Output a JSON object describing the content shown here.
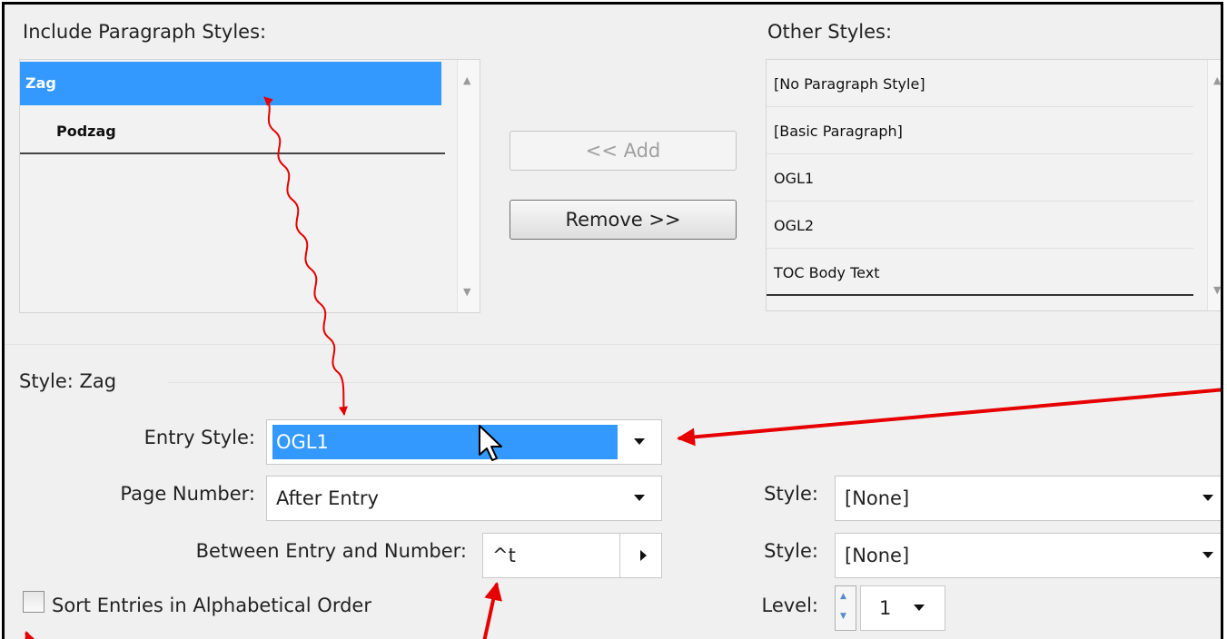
{
  "include_section": {
    "label": "Include Paragraph Styles:",
    "items": [
      "Zag",
      "Podzag"
    ],
    "selected": "Zag"
  },
  "other_section": {
    "label": "Other Styles:",
    "items": [
      "[No Paragraph Style]",
      "[Basic Paragraph]",
      "OGL1",
      "OGL2",
      "TOC Body Text"
    ]
  },
  "buttons": {
    "add": "<< Add",
    "remove": "Remove >>"
  },
  "style_section": {
    "title": "Style: Zag",
    "entry_style": {
      "label": "Entry Style:",
      "value": "OGL1"
    },
    "page_number": {
      "label": "Page Number:",
      "value": "After Entry"
    },
    "between": {
      "label": "Between Entry and Number:",
      "value": "^t"
    },
    "page_style": {
      "label": "Style:",
      "value": "[None]"
    },
    "between_style": {
      "label": "Style:",
      "value": "[None]"
    },
    "sort_label": "Sort Entries in Alphabetical Order",
    "level": {
      "label": "Level:",
      "value": "1"
    }
  },
  "colors": {
    "selection": "#3399ff",
    "annotation": "#e60000"
  }
}
